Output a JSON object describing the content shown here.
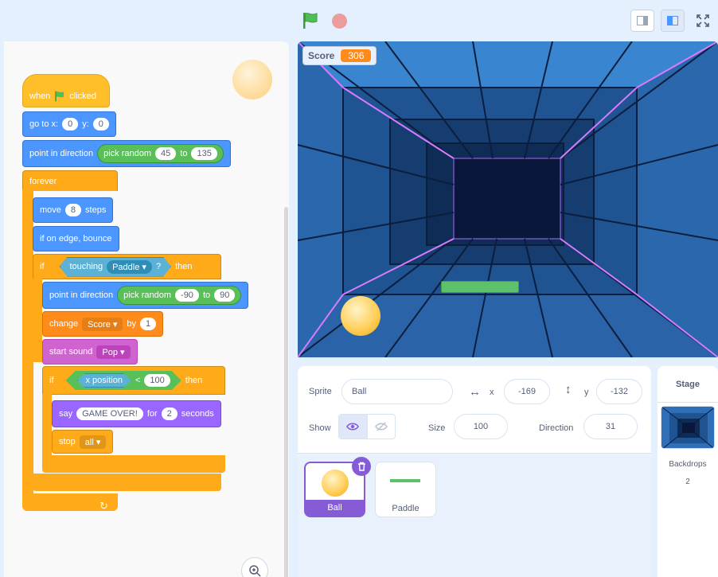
{
  "toolbar": {
    "green_flag_icon": "green-flag-icon",
    "stop_icon": "stop-icon",
    "layout_modes": [
      "small-stage-icon",
      "normal-stage-icon",
      "fullscreen-icon"
    ]
  },
  "script": {
    "hat": {
      "label_when": "when",
      "label_clicked": "clicked"
    },
    "goto": {
      "label": "go to x:",
      "x": "0",
      "y_label": "y:",
      "y": "0"
    },
    "point1": {
      "label": "point in direction",
      "random_label": "pick random",
      "from": "45",
      "to_label": "to",
      "to": "135"
    },
    "forever": {
      "label": "forever"
    },
    "move": {
      "label": "move",
      "steps": "8",
      "suffix": "steps"
    },
    "bounce": {
      "label": "if on edge, bounce"
    },
    "if1": {
      "label_if": "if",
      "touching": "touching",
      "target": "Paddle ▾",
      "q": "?",
      "then": "then"
    },
    "point2": {
      "label": "point in direction",
      "random_label": "pick random",
      "from": "-90",
      "to_label": "to",
      "to": "90"
    },
    "change": {
      "label": "change",
      "var": "Score ▾",
      "by_label": "by",
      "by": "1"
    },
    "sound": {
      "label": "start sound",
      "sound": "Pop ▾"
    },
    "if2": {
      "label_if": "if",
      "xpos": "x position",
      "lt": "<",
      "value": "100",
      "then": "then"
    },
    "say": {
      "label": "say",
      "message": "GAME OVER!",
      "for_label": "for",
      "secs": "2",
      "suffix": "seconds"
    },
    "stop": {
      "label": "stop",
      "option": "all ▾"
    }
  },
  "stage": {
    "monitor_label": "Score",
    "monitor_value": "306"
  },
  "sprite_info": {
    "sprite_label": "Sprite",
    "sprite_name": "Ball",
    "x_arrows": "↔",
    "x_label": "x",
    "x_value": "-169",
    "y_arrows": "↕",
    "y_label": "y",
    "y_value": "-132",
    "show_label": "Show",
    "size_label": "Size",
    "size_value": "100",
    "direction_label": "Direction",
    "direction_value": "31"
  },
  "sprites": [
    {
      "name": "Ball"
    },
    {
      "name": "Paddle"
    }
  ],
  "stage_pane": {
    "title": "Stage",
    "backdrops_label": "Backdrops",
    "backdrops_count": "2"
  },
  "colors": {
    "motion": "#4c97ff",
    "control": "#ffab19",
    "events": "#ffbf2a",
    "looks": "#9966ff",
    "sound": "#cf63cf",
    "operators": "#59c059",
    "sensing": "#5cb1d6",
    "variables": "#ff8c1a"
  }
}
